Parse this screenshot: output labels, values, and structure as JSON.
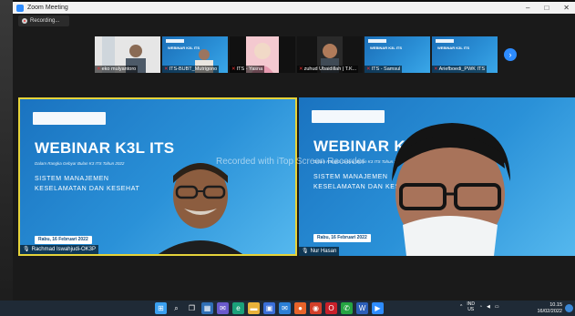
{
  "window": {
    "title": "Zoom Meeting",
    "buttons": [
      "–",
      "□",
      "✕"
    ]
  },
  "recording": {
    "label": "Recording..."
  },
  "participants_strip": [
    {
      "name": "eko mulyantoro",
      "muted": true,
      "kind": "person"
    },
    {
      "name": "ITS-BUBT_Mutrigono",
      "muted": true,
      "kind": "slide"
    },
    {
      "name": "ITS - Yasna",
      "muted": true,
      "kind": "person"
    },
    {
      "name": "zuhud Ubaidillah | T.K...",
      "muted": true,
      "kind": "person"
    },
    {
      "name": "ITS - Samsul",
      "muted": true,
      "kind": "slide"
    },
    {
      "name": "Ariefboedi_PWK ITS",
      "muted": true,
      "kind": "slide"
    }
  ],
  "strip_next_icon": "chevron-right-icon",
  "slide": {
    "title": "WEBINAR K3L ITS",
    "subtitle": "Dalam Rangka Gebyar Bulan K3 ITS Tahun 2022",
    "topic_line1": "SISTEM MANAJEMEN",
    "topic_line2": "KESELAMATAN DAN KESEHAT",
    "date": "Rabu, 16 Februari 2022",
    "mini_title": "WEBINAR K3L ITS"
  },
  "main_tiles": [
    {
      "name": "Rachmad Iswahjudi-OK3P",
      "active_speaker": true
    },
    {
      "name": "Nur Hasan",
      "active_speaker": false
    }
  ],
  "watermark": "Recorded with iTop Screen Recorder",
  "taskbar": {
    "icons": [
      "windows-icon",
      "search-icon",
      "task-view-icon",
      "widgets-icon",
      "chat-icon",
      "edge-icon",
      "file-explorer-icon",
      "store-icon",
      "mail-icon",
      "firefox-icon",
      "chrome-icon",
      "opera-icon",
      "whatsapp-icon",
      "word-icon",
      "zoom-icon"
    ],
    "whatsapp_badge": "3",
    "language": "IND",
    "region": "US",
    "time": "10.15",
    "date": "16/02/2022"
  }
}
